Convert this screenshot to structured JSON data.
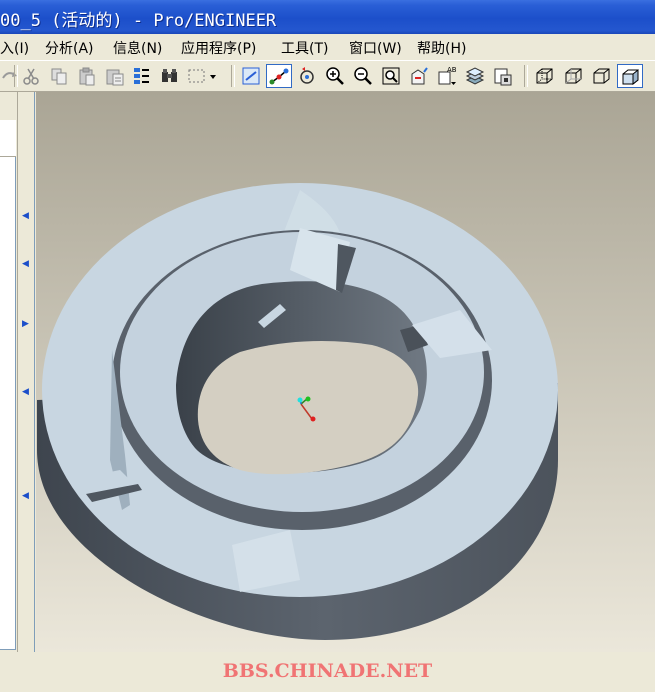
{
  "window": {
    "title": "00_5 (活动的) - Pro/ENGINEER"
  },
  "menu": {
    "items": [
      {
        "id": "insert",
        "label": "入(I)"
      },
      {
        "id": "analysis",
        "label": "分析(A)"
      },
      {
        "id": "info",
        "label": "信息(N)"
      },
      {
        "id": "applications",
        "label": "应用程序(P)"
      },
      {
        "id": "tools",
        "label": "工具(T)"
      },
      {
        "id": "window",
        "label": "窗口(W)"
      },
      {
        "id": "help",
        "label": "帮助(H)"
      }
    ]
  },
  "toolbar": {
    "buttons": [
      "redo-icon",
      "cut-icon",
      "copy-icon",
      "paste-icon",
      "paste-special-icon",
      "regenerate-icon",
      "find-icon",
      "select-box-icon",
      "repaint-icon",
      "spin-center-icon",
      "orient-mode-icon",
      "zoom-in-icon",
      "zoom-out-icon",
      "refit-icon",
      "reorient-icon",
      "saved-views-icon",
      "layers-icon",
      "view-manager-icon",
      "wireframe-icon",
      "hidden-line-icon",
      "no-hidden-icon",
      "shading-icon"
    ],
    "active": [
      "spin-center-icon",
      "shading-icon"
    ]
  },
  "viewport": {
    "background_top": "#aaa595",
    "background_bottom": "#ebe7da",
    "model_color": "#c8d6e1",
    "model_shadow": "#59616b"
  },
  "watermark": {
    "text": "BBS.CHINADE.NET",
    "color": "#f07474"
  }
}
